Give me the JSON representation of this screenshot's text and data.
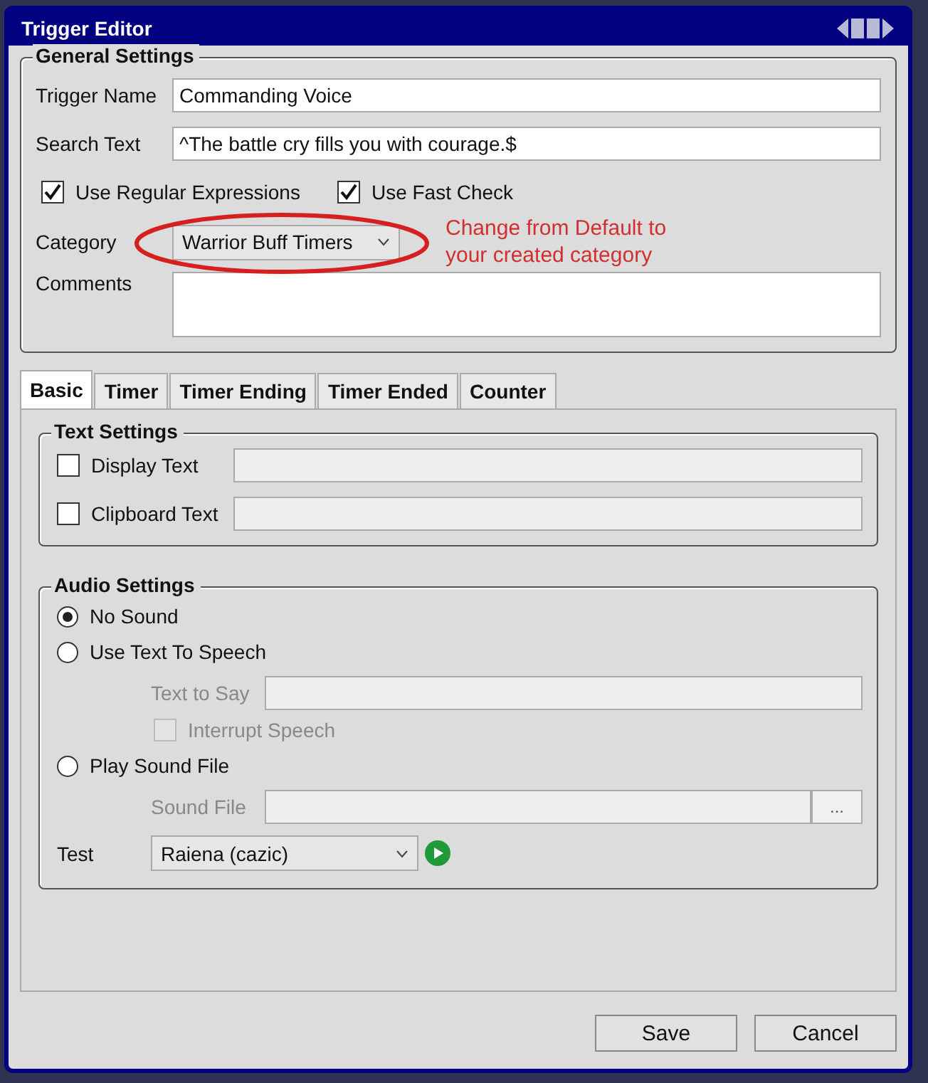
{
  "window": {
    "title": "Trigger Editor"
  },
  "general_settings": {
    "title": "General Settings",
    "fields": [
      {
        "label": "Trigger Name",
        "value": "Commanding Voice"
      },
      {
        "label": "Search Text",
        "value": "^The battle cry fills you with courage.$"
      }
    ],
    "checkboxes": [
      {
        "label": "Use Regular Expressions",
        "checked": true
      },
      {
        "label": "Use Fast Check",
        "checked": true
      }
    ],
    "category": {
      "label": "Category",
      "value": "Warrior Buff Timers",
      "circled": true
    },
    "annotation": "Change from Default to\nyour created category",
    "comments": {
      "label": "Comments"
    }
  },
  "tabs": [
    {
      "label": "Basic",
      "selected": true
    },
    {
      "label": "Timer",
      "selected": false
    },
    {
      "label": "Timer Ending",
      "selected": false
    },
    {
      "label": "Timer Ended",
      "selected": false
    },
    {
      "label": "Counter",
      "selected": false
    }
  ],
  "text_settings": {
    "title": "Text Settings",
    "rows": [
      {
        "label": "Display Text",
        "checked": false
      },
      {
        "label": "Clipboard Text",
        "checked": false
      }
    ]
  },
  "audio_settings": {
    "title": "Audio Settings",
    "options": [
      {
        "kind": "radio",
        "label": "No Sound",
        "selected": true
      },
      {
        "kind": "radio",
        "label": "Use Text To Speech",
        "selected": false
      },
      {
        "kind": "field",
        "label": "Text to Say",
        "disabled": true
      },
      {
        "kind": "checkbox",
        "label": "Interrupt Speech",
        "checked": false,
        "disabled": true
      },
      {
        "kind": "radio",
        "label": "Play Sound File",
        "selected": false
      },
      {
        "kind": "file",
        "label": "Sound File",
        "button": "...",
        "disabled": true
      }
    ],
    "test": {
      "label": "Test",
      "value": "Raiena (cazic)"
    }
  },
  "buttons": [
    "Save",
    "Cancel"
  ]
}
